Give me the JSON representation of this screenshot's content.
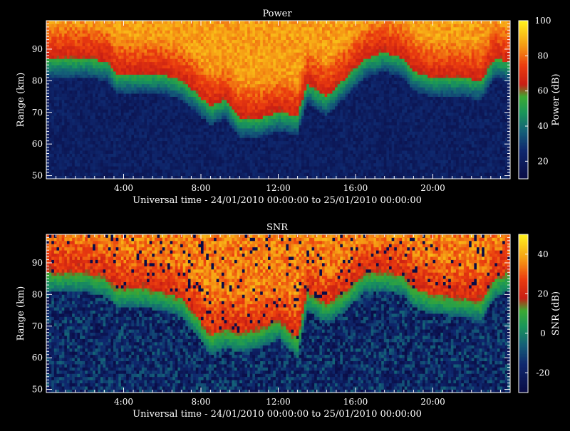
{
  "chart_data": [
    {
      "type": "heatmap",
      "title": "Power",
      "xlabel": "Universal time - 24/01/2010 00:00:00 to 25/01/2010 00:00:00",
      "ylabel": "Range (km)",
      "x_ticks": [
        "4:00",
        "8:00",
        "12:00",
        "16:00",
        "20:00"
      ],
      "x_tick_hours": [
        4,
        8,
        12,
        16,
        20
      ],
      "xlim_hours": [
        0,
        24
      ],
      "y_ticks": [
        50,
        60,
        70,
        80,
        90
      ],
      "ylim": [
        49,
        99
      ],
      "colorbar": {
        "label": "Power (dB)",
        "ticks": [
          20,
          40,
          60,
          80,
          100
        ],
        "range": [
          10,
          100
        ]
      },
      "layer_boundary_km": [
        {
          "hour": 0,
          "km": 84
        },
        {
          "hour": 2,
          "km": 84
        },
        {
          "hour": 3.2,
          "km": 83
        },
        {
          "hour": 3.6,
          "km": 79
        },
        {
          "hour": 5,
          "km": 79
        },
        {
          "hour": 6,
          "km": 79
        },
        {
          "hour": 7,
          "km": 77
        },
        {
          "hour": 7.8,
          "km": 73
        },
        {
          "hour": 8.5,
          "km": 69
        },
        {
          "hour": 9.3,
          "km": 71
        },
        {
          "hour": 10,
          "km": 65
        },
        {
          "hour": 11,
          "km": 65
        },
        {
          "hour": 12,
          "km": 67
        },
        {
          "hour": 13,
          "km": 66
        },
        {
          "hour": 13.5,
          "km": 76
        },
        {
          "hour": 14.5,
          "km": 72
        },
        {
          "hour": 15.5,
          "km": 78
        },
        {
          "hour": 16.5,
          "km": 84
        },
        {
          "hour": 17.5,
          "km": 86
        },
        {
          "hour": 18.5,
          "km": 84
        },
        {
          "hour": 19,
          "km": 80
        },
        {
          "hour": 20,
          "km": 78
        },
        {
          "hour": 21.5,
          "km": 78
        },
        {
          "hour": 22.5,
          "km": 77
        },
        {
          "hour": 23.2,
          "km": 84
        },
        {
          "hour": 24,
          "km": 83
        }
      ],
      "power_above_layer_db": [
        55,
        95
      ],
      "power_below_layer_db": [
        15,
        30
      ]
    },
    {
      "type": "heatmap",
      "title": "SNR",
      "xlabel": "Universal time - 24/01/2010 00:00:00 to 25/01/2010 00:00:00",
      "ylabel": "Range (km)",
      "x_ticks": [
        "4:00",
        "8:00",
        "12:00",
        "16:00",
        "20:00"
      ],
      "x_tick_hours": [
        4,
        8,
        12,
        16,
        20
      ],
      "xlim_hours": [
        0,
        24
      ],
      "y_ticks": [
        50,
        60,
        70,
        80,
        90
      ],
      "ylim": [
        49,
        99
      ],
      "colorbar": {
        "label": "SNR (dB)",
        "ticks": [
          -20,
          0,
          20,
          40
        ],
        "range": [
          -30,
          50
        ]
      },
      "layer_boundary_km": [
        {
          "hour": 0,
          "km": 84
        },
        {
          "hour": 2,
          "km": 84
        },
        {
          "hour": 3.2,
          "km": 82
        },
        {
          "hour": 3.6,
          "km": 79
        },
        {
          "hour": 5,
          "km": 79
        },
        {
          "hour": 6,
          "km": 78
        },
        {
          "hour": 7,
          "km": 76
        },
        {
          "hour": 7.8,
          "km": 70
        },
        {
          "hour": 8.5,
          "km": 64
        },
        {
          "hour": 9.3,
          "km": 66
        },
        {
          "hour": 10,
          "km": 65
        },
        {
          "hour": 11,
          "km": 66
        },
        {
          "hour": 12,
          "km": 69
        },
        {
          "hour": 13,
          "km": 63
        },
        {
          "hour": 13.5,
          "km": 78
        },
        {
          "hour": 14.5,
          "km": 74
        },
        {
          "hour": 15.5,
          "km": 78
        },
        {
          "hour": 16.5,
          "km": 84
        },
        {
          "hour": 17.5,
          "km": 84
        },
        {
          "hour": 18.5,
          "km": 83
        },
        {
          "hour": 19,
          "km": 79
        },
        {
          "hour": 20,
          "km": 77
        },
        {
          "hour": 21.5,
          "km": 76
        },
        {
          "hour": 22.5,
          "km": 75
        },
        {
          "hour": 23.2,
          "km": 82
        },
        {
          "hour": 24,
          "km": 84
        }
      ],
      "snr_above_layer_db": [
        15,
        40
      ],
      "snr_below_layer_db": [
        -30,
        -5
      ]
    }
  ]
}
